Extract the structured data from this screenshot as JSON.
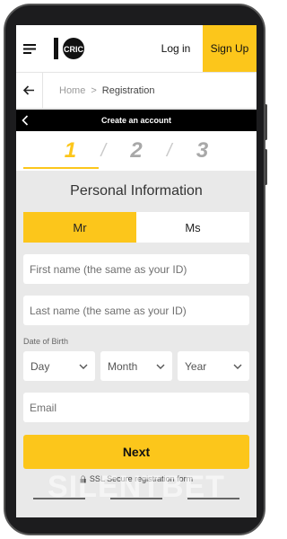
{
  "header": {
    "login_label": "Log in",
    "signup_label": "Sign Up",
    "logo_text": "CRIC"
  },
  "breadcrumb": {
    "home": "Home",
    "separator": ">",
    "current": "Registration"
  },
  "create_bar": {
    "title": "Create an account"
  },
  "steps": {
    "items": [
      "1",
      "2",
      "3"
    ],
    "separator": "/",
    "active": 1
  },
  "form": {
    "section_title": "Personal Information",
    "gender": {
      "mr": "Mr",
      "ms": "Ms",
      "selected": "Mr"
    },
    "first_name_placeholder": "First name (the same as your ID)",
    "last_name_placeholder": "Last name (the same as your ID)",
    "dob_label": "Date of Birth",
    "day_label": "Day",
    "month_label": "Month",
    "year_label": "Year",
    "email_placeholder": "Email",
    "next_label": "Next",
    "ssl_text": "SSL Secure registration form"
  },
  "watermark": "SILENTBET",
  "colors": {
    "accent": "#fcc61b",
    "dark_bar": "#000000",
    "background": "#e9e9e9"
  }
}
